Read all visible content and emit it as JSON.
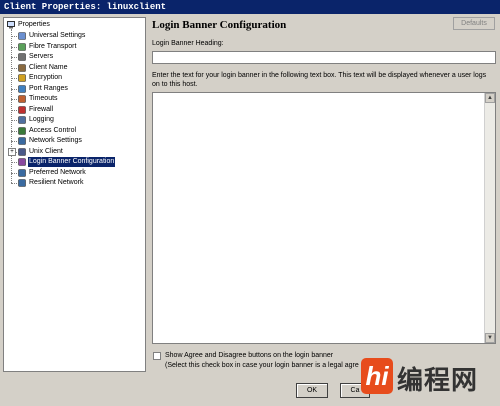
{
  "window": {
    "title": "Client Properties: linuxclient"
  },
  "tree": {
    "root": "Properties",
    "items": [
      {
        "label": "Universal Settings",
        "icon": "settings-icon"
      },
      {
        "label": "Fibre Transport",
        "icon": "fibre-icon"
      },
      {
        "label": "Servers",
        "icon": "servers-icon"
      },
      {
        "label": "Client Name",
        "icon": "client-icon"
      },
      {
        "label": "Encryption",
        "icon": "lock-icon"
      },
      {
        "label": "Port Ranges",
        "icon": "port-icon"
      },
      {
        "label": "Timeouts",
        "icon": "clock-icon"
      },
      {
        "label": "Firewall",
        "icon": "firewall-icon"
      },
      {
        "label": "Logging",
        "icon": "log-icon"
      },
      {
        "label": "Access Control",
        "icon": "access-icon"
      },
      {
        "label": "Network Settings",
        "icon": "network-icon"
      },
      {
        "label": "Unix Client",
        "icon": "computer-icon"
      },
      {
        "label": "Login Banner Configuration",
        "icon": "banner-icon"
      },
      {
        "label": "Preferred Network",
        "icon": "network-icon"
      },
      {
        "label": "Resilient Network",
        "icon": "network-icon"
      }
    ],
    "selected": "Login Banner Configuration"
  },
  "panel": {
    "title": "Login Banner Configuration",
    "defaults_label": "Defaults",
    "heading_label": "Login Banner Heading:",
    "heading_value": "",
    "description": "Enter the text for your login banner in the following text box. This text will be displayed whenever a user logs on to this host.",
    "banner_text": "",
    "checkbox_label": "Show Agree and Disagree buttons on the login banner",
    "checkbox_hint": "(Select this check box in case your login banner is a legal agre",
    "checkbox_checked": false
  },
  "buttons": {
    "ok": "OK",
    "cancel": "Ca"
  },
  "watermark": {
    "badge": "hi",
    "text": "编程网"
  },
  "colors": {
    "selection": "#0a246a",
    "titlebar": "#0a246a",
    "dialog_bg": "#d4d0c8",
    "logo_accent": "#e74c1c"
  }
}
